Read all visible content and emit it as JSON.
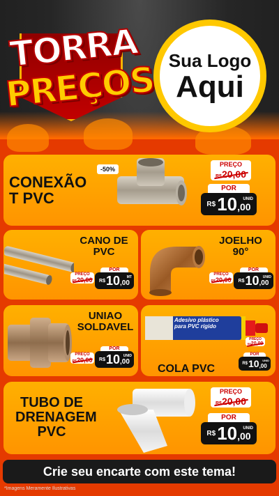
{
  "header": {
    "title_line1": "TORRA",
    "title_line2": "PREÇOS",
    "logo_line1": "Sua Logo",
    "logo_line2": "Aqui"
  },
  "colors": {
    "card": "#ff9e00",
    "accent_red": "#cc0000",
    "price_bg": "#111111",
    "logo_ring": "#ffc800"
  },
  "products": [
    {
      "name_line1": "CONEXÃO",
      "name_line2": "T PVC",
      "discount": "-50%",
      "preco_label": "PREÇO",
      "old_currency": "R$",
      "old_price": "20,00",
      "por_label": "POR",
      "currency": "R$",
      "price_int": "10",
      "price_dec": ",00",
      "unit": "UNID"
    },
    {
      "name_line1": "CANO DE",
      "name_line2": "PVC",
      "preco_label": "PREÇO",
      "old_currency": "R$",
      "old_price": "20,00",
      "por_label": "POR",
      "currency": "R$",
      "price_int": "10",
      "price_dec": ",00",
      "unit": "MT"
    },
    {
      "name_line1": "JOELHO",
      "name_line2": "90°",
      "preco_label": "PREÇO",
      "old_currency": "R$",
      "old_price": "20,00",
      "por_label": "POR",
      "currency": "R$",
      "price_int": "10",
      "price_dec": ",00",
      "unit": "UNID"
    },
    {
      "name_line1": "UNIAO",
      "name_line2": "SOLDAVEL",
      "preco_label": "PREÇO",
      "old_currency": "R$",
      "old_price": "20,00",
      "por_label": "POR",
      "currency": "R$",
      "price_int": "10",
      "price_dec": ",00",
      "unit": "UNID"
    },
    {
      "name_line1": "COLA PVC",
      "tube_text1": "Adesivo plástico",
      "tube_text2": "para PVC rígido",
      "preco_label": "PREÇO",
      "old_currency": "R$",
      "old_price": "20,00",
      "por_label": "POR",
      "currency": "R$",
      "price_int": "10",
      "price_dec": ",00",
      "unit": "UNID"
    },
    {
      "name_line1": "TUBO DE",
      "name_line2": "DRENAGEM",
      "name_line3": "PVC",
      "preco_label": "PREÇO",
      "old_currency": "R$",
      "old_price": "20,00",
      "por_label": "POR",
      "currency": "R$",
      "price_int": "10",
      "price_dec": ",00",
      "unit": "UNID"
    }
  ],
  "footer": {
    "cta": "Crie seu encarte com este tema!",
    "disclaimer": "*Imagens Meramente Ilustrativas"
  }
}
